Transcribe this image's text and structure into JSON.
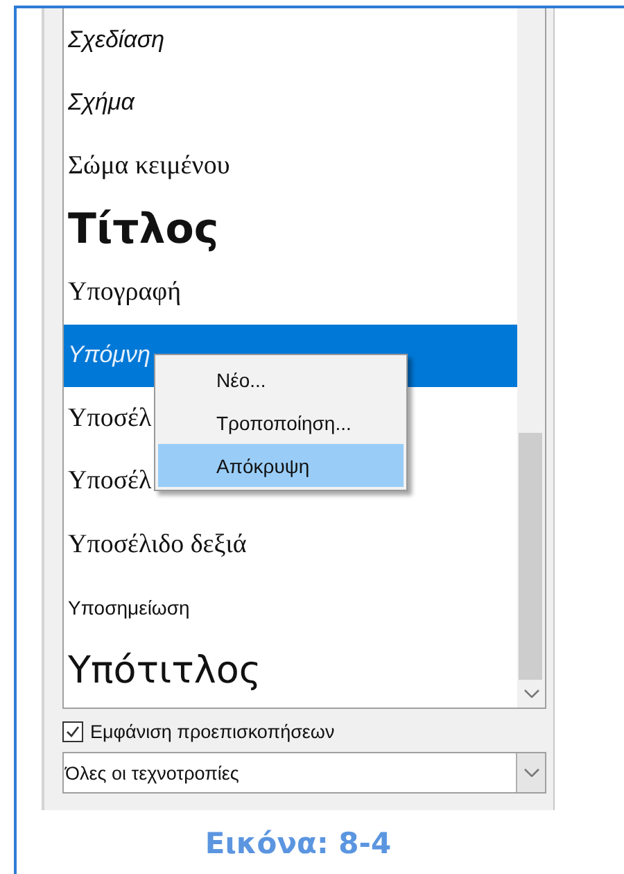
{
  "styles_list": {
    "items": [
      {
        "label": "Σχεδίαση",
        "kind": "italic",
        "selected": false
      },
      {
        "label": "Σχήμα",
        "kind": "italic",
        "selected": false
      },
      {
        "label": "Σώμα κειμένου",
        "kind": "serif",
        "selected": false
      },
      {
        "label": "Τίτλος",
        "kind": "title",
        "selected": false
      },
      {
        "label": "Υπογραφή",
        "kind": "serif",
        "selected": false
      },
      {
        "label": "Υπόμνη",
        "kind": "italic",
        "selected": true
      },
      {
        "label": "Υποσέλ",
        "kind": "serif",
        "selected": false
      },
      {
        "label": "Υποσέλ",
        "kind": "serif",
        "selected": false
      },
      {
        "label": "Υποσέλιδο δεξιά",
        "kind": "serif",
        "selected": false
      },
      {
        "label": "Υποσημείωση",
        "kind": "small",
        "selected": false
      },
      {
        "label": "Υπότιτλος",
        "kind": "subtitle",
        "selected": false
      }
    ]
  },
  "context_menu": {
    "items": [
      {
        "label": "Νέο...",
        "selected": false
      },
      {
        "label": "Τροποποίηση...",
        "selected": false
      },
      {
        "label": "Απόκρυψη",
        "selected": true
      }
    ]
  },
  "show_previews": {
    "label": "Εμφάνιση προεπισκοπήσεων",
    "checked": true
  },
  "filter": {
    "value": "Όλες οι τεχνοτροπίες"
  },
  "caption": "Εικόνα: 8-4"
}
